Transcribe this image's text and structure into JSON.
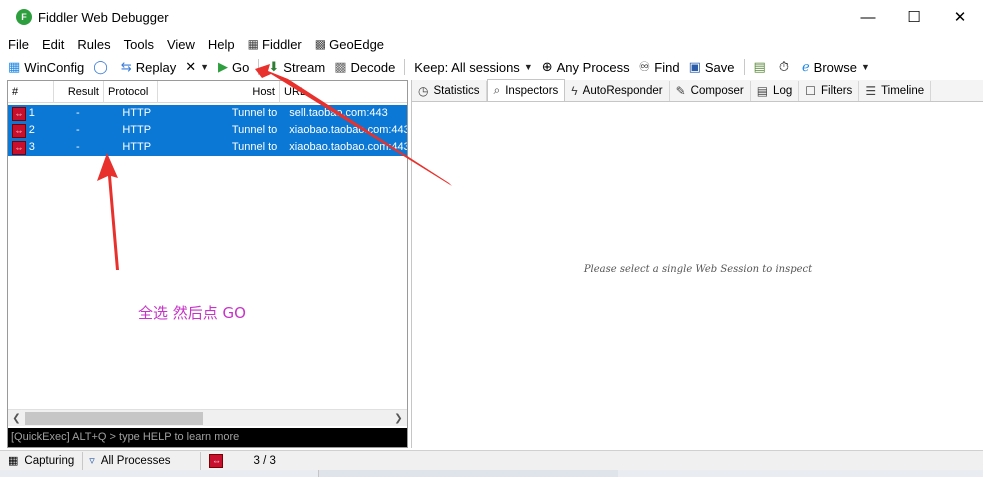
{
  "window": {
    "title": "Fiddler Web Debugger",
    "minimize": "—",
    "maximize": "☐",
    "close": "✕"
  },
  "menu": [
    "File",
    "Edit",
    "Rules",
    "Tools",
    "View",
    "Help",
    "Fiddler",
    "GeoEdge"
  ],
  "toolbar": {
    "winconfig": "WinConfig",
    "replay": "Replay",
    "remove": "✕",
    "go": "Go",
    "stream": "Stream",
    "decode": "Decode",
    "keep": "Keep: All sessions",
    "process": "Any Process",
    "find": "Find",
    "save": "Save",
    "browse": "Browse"
  },
  "sessions": {
    "columns": [
      "#",
      "Result",
      "Protocol",
      "Host",
      "URL"
    ],
    "rows": [
      {
        "id": "1",
        "result": "-",
        "protocol": "HTTP",
        "host": "Tunnel to",
        "url": "sell.taobao.com:443"
      },
      {
        "id": "2",
        "result": "-",
        "protocol": "HTTP",
        "host": "Tunnel to",
        "url": "xiaobao.taobao.com:443"
      },
      {
        "id": "3",
        "result": "-",
        "protocol": "HTTP",
        "host": "Tunnel to",
        "url": "xiaobao.taobao.com:443"
      }
    ],
    "quickexec_placeholder": "[QuickExec] ALT+Q > type HELP to learn more"
  },
  "annotation": {
    "text": "全选 然后点 GO",
    "color": "#c733c7",
    "arrow_color": "#e8312c"
  },
  "tabs": [
    "Statistics",
    "Inspectors",
    "AutoResponder",
    "Composer",
    "Log",
    "Filters",
    "Timeline"
  ],
  "active_tab": "Inspectors",
  "inspector_placeholder": "Please select a single Web Session to inspect",
  "status": {
    "capturing": "Capturing",
    "processes": "All Processes",
    "count": "3 / 3"
  },
  "colors": {
    "selection": "#0a78d4",
    "session_icon": "#c8102e"
  }
}
